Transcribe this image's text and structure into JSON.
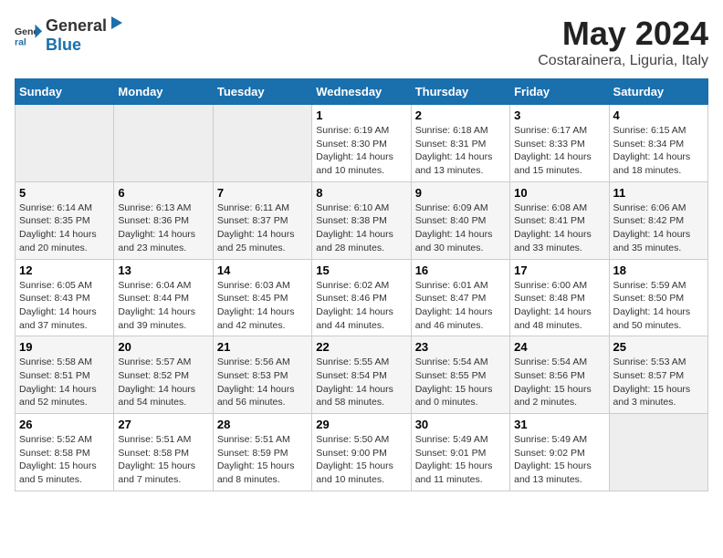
{
  "header": {
    "logo": {
      "general": "General",
      "blue": "Blue"
    },
    "title": "May 2024",
    "location": "Costarainera, Liguria, Italy"
  },
  "weekdays": [
    "Sunday",
    "Monday",
    "Tuesday",
    "Wednesday",
    "Thursday",
    "Friday",
    "Saturday"
  ],
  "weeks": [
    [
      null,
      null,
      null,
      {
        "day": "1",
        "sunrise": "Sunrise: 6:19 AM",
        "sunset": "Sunset: 8:30 PM",
        "daylight": "Daylight: 14 hours and 10 minutes."
      },
      {
        "day": "2",
        "sunrise": "Sunrise: 6:18 AM",
        "sunset": "Sunset: 8:31 PM",
        "daylight": "Daylight: 14 hours and 13 minutes."
      },
      {
        "day": "3",
        "sunrise": "Sunrise: 6:17 AM",
        "sunset": "Sunset: 8:33 PM",
        "daylight": "Daylight: 14 hours and 15 minutes."
      },
      {
        "day": "4",
        "sunrise": "Sunrise: 6:15 AM",
        "sunset": "Sunset: 8:34 PM",
        "daylight": "Daylight: 14 hours and 18 minutes."
      }
    ],
    [
      {
        "day": "5",
        "sunrise": "Sunrise: 6:14 AM",
        "sunset": "Sunset: 8:35 PM",
        "daylight": "Daylight: 14 hours and 20 minutes."
      },
      {
        "day": "6",
        "sunrise": "Sunrise: 6:13 AM",
        "sunset": "Sunset: 8:36 PM",
        "daylight": "Daylight: 14 hours and 23 minutes."
      },
      {
        "day": "7",
        "sunrise": "Sunrise: 6:11 AM",
        "sunset": "Sunset: 8:37 PM",
        "daylight": "Daylight: 14 hours and 25 minutes."
      },
      {
        "day": "8",
        "sunrise": "Sunrise: 6:10 AM",
        "sunset": "Sunset: 8:38 PM",
        "daylight": "Daylight: 14 hours and 28 minutes."
      },
      {
        "day": "9",
        "sunrise": "Sunrise: 6:09 AM",
        "sunset": "Sunset: 8:40 PM",
        "daylight": "Daylight: 14 hours and 30 minutes."
      },
      {
        "day": "10",
        "sunrise": "Sunrise: 6:08 AM",
        "sunset": "Sunset: 8:41 PM",
        "daylight": "Daylight: 14 hours and 33 minutes."
      },
      {
        "day": "11",
        "sunrise": "Sunrise: 6:06 AM",
        "sunset": "Sunset: 8:42 PM",
        "daylight": "Daylight: 14 hours and 35 minutes."
      }
    ],
    [
      {
        "day": "12",
        "sunrise": "Sunrise: 6:05 AM",
        "sunset": "Sunset: 8:43 PM",
        "daylight": "Daylight: 14 hours and 37 minutes."
      },
      {
        "day": "13",
        "sunrise": "Sunrise: 6:04 AM",
        "sunset": "Sunset: 8:44 PM",
        "daylight": "Daylight: 14 hours and 39 minutes."
      },
      {
        "day": "14",
        "sunrise": "Sunrise: 6:03 AM",
        "sunset": "Sunset: 8:45 PM",
        "daylight": "Daylight: 14 hours and 42 minutes."
      },
      {
        "day": "15",
        "sunrise": "Sunrise: 6:02 AM",
        "sunset": "Sunset: 8:46 PM",
        "daylight": "Daylight: 14 hours and 44 minutes."
      },
      {
        "day": "16",
        "sunrise": "Sunrise: 6:01 AM",
        "sunset": "Sunset: 8:47 PM",
        "daylight": "Daylight: 14 hours and 46 minutes."
      },
      {
        "day": "17",
        "sunrise": "Sunrise: 6:00 AM",
        "sunset": "Sunset: 8:48 PM",
        "daylight": "Daylight: 14 hours and 48 minutes."
      },
      {
        "day": "18",
        "sunrise": "Sunrise: 5:59 AM",
        "sunset": "Sunset: 8:50 PM",
        "daylight": "Daylight: 14 hours and 50 minutes."
      }
    ],
    [
      {
        "day": "19",
        "sunrise": "Sunrise: 5:58 AM",
        "sunset": "Sunset: 8:51 PM",
        "daylight": "Daylight: 14 hours and 52 minutes."
      },
      {
        "day": "20",
        "sunrise": "Sunrise: 5:57 AM",
        "sunset": "Sunset: 8:52 PM",
        "daylight": "Daylight: 14 hours and 54 minutes."
      },
      {
        "day": "21",
        "sunrise": "Sunrise: 5:56 AM",
        "sunset": "Sunset: 8:53 PM",
        "daylight": "Daylight: 14 hours and 56 minutes."
      },
      {
        "day": "22",
        "sunrise": "Sunrise: 5:55 AM",
        "sunset": "Sunset: 8:54 PM",
        "daylight": "Daylight: 14 hours and 58 minutes."
      },
      {
        "day": "23",
        "sunrise": "Sunrise: 5:54 AM",
        "sunset": "Sunset: 8:55 PM",
        "daylight": "Daylight: 15 hours and 0 minutes."
      },
      {
        "day": "24",
        "sunrise": "Sunrise: 5:54 AM",
        "sunset": "Sunset: 8:56 PM",
        "daylight": "Daylight: 15 hours and 2 minutes."
      },
      {
        "day": "25",
        "sunrise": "Sunrise: 5:53 AM",
        "sunset": "Sunset: 8:57 PM",
        "daylight": "Daylight: 15 hours and 3 minutes."
      }
    ],
    [
      {
        "day": "26",
        "sunrise": "Sunrise: 5:52 AM",
        "sunset": "Sunset: 8:58 PM",
        "daylight": "Daylight: 15 hours and 5 minutes."
      },
      {
        "day": "27",
        "sunrise": "Sunrise: 5:51 AM",
        "sunset": "Sunset: 8:58 PM",
        "daylight": "Daylight: 15 hours and 7 minutes."
      },
      {
        "day": "28",
        "sunrise": "Sunrise: 5:51 AM",
        "sunset": "Sunset: 8:59 PM",
        "daylight": "Daylight: 15 hours and 8 minutes."
      },
      {
        "day": "29",
        "sunrise": "Sunrise: 5:50 AM",
        "sunset": "Sunset: 9:00 PM",
        "daylight": "Daylight: 15 hours and 10 minutes."
      },
      {
        "day": "30",
        "sunrise": "Sunrise: 5:49 AM",
        "sunset": "Sunset: 9:01 PM",
        "daylight": "Daylight: 15 hours and 11 minutes."
      },
      {
        "day": "31",
        "sunrise": "Sunrise: 5:49 AM",
        "sunset": "Sunset: 9:02 PM",
        "daylight": "Daylight: 15 hours and 13 minutes."
      },
      null
    ]
  ]
}
